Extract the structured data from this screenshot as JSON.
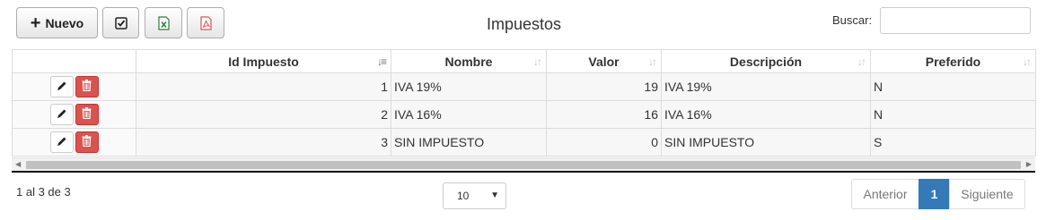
{
  "toolbar": {
    "new_label": "Nuevo",
    "new_icon": "plus-icon",
    "check_icon": "checklist-icon",
    "excel_icon": "excel-file-icon",
    "pdf_icon": "pdf-file-icon"
  },
  "title": "Impuestos",
  "search": {
    "label": "Buscar:",
    "value": "",
    "placeholder": ""
  },
  "table": {
    "columns": [
      "",
      "Id Impuesto",
      "Nombre",
      "Valor",
      "Descripción",
      "Preferido"
    ],
    "rows": [
      {
        "id": "1",
        "nombre": "IVA 19%",
        "valor": "19",
        "descripcion": "IVA 19%",
        "preferido": "N"
      },
      {
        "id": "2",
        "nombre": "IVA 16%",
        "valor": "16",
        "descripcion": "IVA 16%",
        "preferido": "N"
      },
      {
        "id": "3",
        "nombre": "SIN IMPUESTO",
        "valor": "0",
        "descripcion": "SIN IMPUESTO",
        "preferido": "S"
      }
    ]
  },
  "footer": {
    "info": "1 al 3 de 3",
    "page_size": "10",
    "prev_label": "Anterior",
    "current_page": "1",
    "next_label": "Siguiente"
  },
  "colors": {
    "accent": "#337ab7",
    "delete": "#d9534f",
    "excel": "#2e7d32",
    "pdf": "#d9534f"
  }
}
